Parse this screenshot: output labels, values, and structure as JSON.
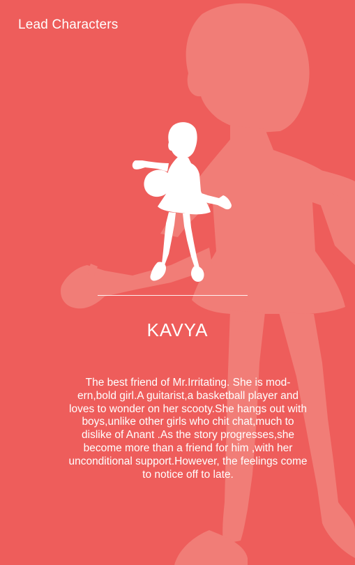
{
  "header": {
    "title": "Lead Characters"
  },
  "character": {
    "name": "KAVYA",
    "description": "The best friend of Mr.Irritating. She is mod-ern,bold girl.A guitarist,a basketball player and loves to wonder on her scooty.She hangs out with boys,unlike other girls who chit chat,much to dislike of Anant .As the story progresses,she become more than a friend for him ,with her unconditional support.However, the feelings come to notice off to late."
  },
  "colors": {
    "background": "#ee5d5b",
    "silhouette_large": "#f17d77",
    "silhouette_small": "#ffffff"
  }
}
